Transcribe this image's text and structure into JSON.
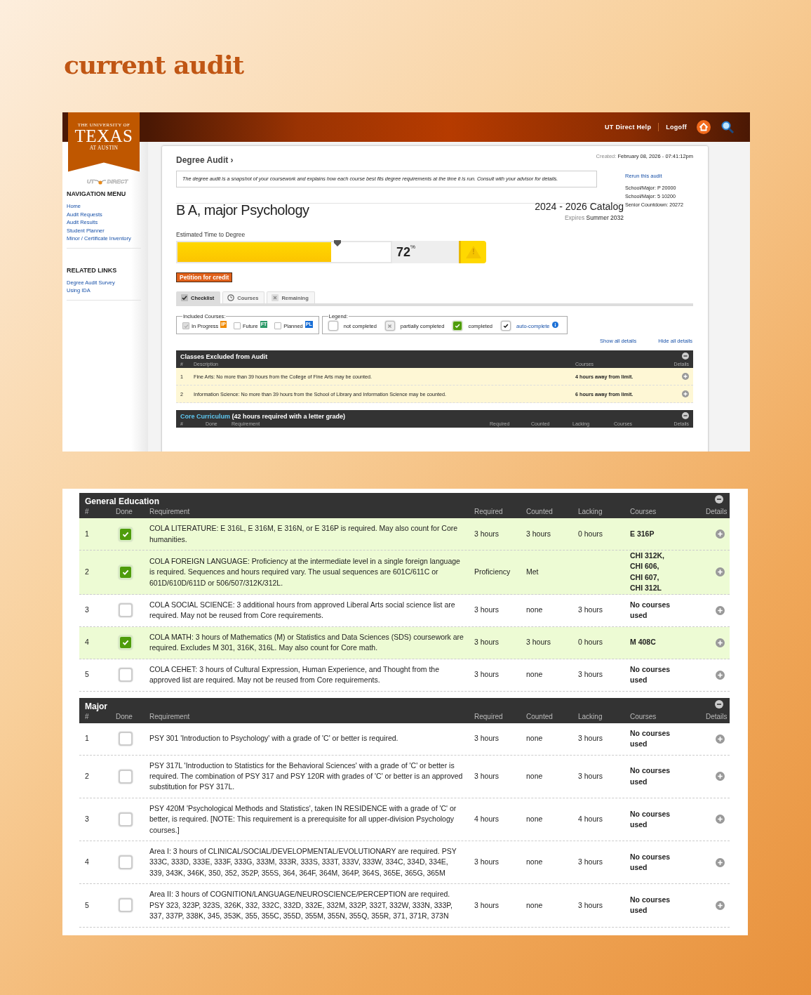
{
  "page_title": "current audit",
  "portal": {
    "header_links": [
      "UT Direct Help",
      "Logoff"
    ],
    "logo": {
      "line1": "THE UNIVERSITY OF",
      "line2": "TEXAS",
      "line3": "AT AUSTIN",
      "brand_left": "UT",
      "brand_right": "DIRECT"
    },
    "nav_sections": [
      {
        "title": "NAVIGATION MENU",
        "links": [
          "Home",
          "Audit Requests",
          "Audit Results",
          "Student Planner",
          "Minor / Certificate Inventory"
        ]
      },
      {
        "title": "RELATED LINKS",
        "links": [
          "Degree Audit Survey",
          "Using IDA"
        ]
      }
    ],
    "audit": {
      "breadcrumb": "Degree Audit ›",
      "created_label": "Created:",
      "created_value": "February 08, 2026 - 07:41:12pm",
      "notice": "The degree audit is a snapshot of your coursework and explains how each course best fits degree requirements at the time it is run. Consult with your advisor for details.",
      "rerun": "Rerun this audit",
      "info_lines": [
        "School/Major: P 20000",
        "School/Major: 5 10200",
        "Senior Countdown: 20272"
      ],
      "degree": "B A, major Psychology",
      "catalog": "2024 - 2026 Catalog",
      "expires_label": "Expires",
      "expires_value": "Summer 2032",
      "progress": {
        "label": "Estimated Time to Degree",
        "level": 0.72,
        "reading": "72",
        "unit": "%",
        "warning": "!"
      },
      "petition": "Petition for credit",
      "tabs": [
        {
          "label": "Checklist",
          "kind": "check",
          "selected": true
        },
        {
          "label": "Courses",
          "kind": "clock",
          "selected": false
        },
        {
          "label": "Remaining",
          "kind": "cross",
          "selected": false
        }
      ],
      "included": {
        "legend": "Included Courses:",
        "items": [
          {
            "label": "In Progress",
            "checked": true,
            "badge": "IP",
            "color": "#f08a00"
          },
          {
            "label": "Future",
            "checked": false,
            "badge": "FT",
            "color": "#2e9a6a"
          },
          {
            "label": "Planned",
            "checked": false,
            "badge": "PL",
            "color": "#1a6fd6"
          }
        ]
      },
      "legend": {
        "legend": "Legend:",
        "items": [
          {
            "kind": "empty",
            "label": "not completed"
          },
          {
            "kind": "partial",
            "label": "partially completed"
          },
          {
            "kind": "complete",
            "label": "completed"
          },
          {
            "kind": "auto",
            "label": "auto-complete"
          }
        ]
      },
      "detail_links": [
        "Show all details",
        "Hide all details"
      ],
      "excluded": {
        "title": "Classes Excluded from Audit",
        "columns": [
          "#",
          "Description",
          "Courses",
          "Details"
        ],
        "rows": [
          {
            "num": "1",
            "description": "Fine Arts: No more than 39 hours from the College of Fine Arts may be counted.",
            "courses": "4 hours away from limit."
          },
          {
            "num": "2",
            "description": "Information Science: No more than 39 hours from the School of Library and Information Science may be counted.",
            "courses": "6 hours away from limit."
          }
        ]
      },
      "core": {
        "title_link": "Core Curriculum",
        "title_rest": "(42 hours required with a letter grade)",
        "columns": [
          "#",
          "Done",
          "Requirement",
          "Required",
          "Counted",
          "Lacking",
          "Courses",
          "Details"
        ]
      }
    }
  },
  "detail": {
    "sections": [
      {
        "title": "General Education",
        "columns": [
          "#",
          "Done",
          "Requirement",
          "Required",
          "Counted",
          "Lacking",
          "Courses",
          "Details"
        ],
        "rows": [
          {
            "num": "1",
            "done": true,
            "requirement": "COLA LITERATURE: E 316L, E 316M, E 316N, or E 316P is required. May also count for Core humanities.",
            "required": "3 hours",
            "counted": "3 hours",
            "lacking": "0 hours",
            "courses": "E 316P"
          },
          {
            "num": "2",
            "done": true,
            "requirement": "COLA FOREIGN LANGUAGE: Proficiency at the intermediate level in a single foreign language is required. Sequences and hours required vary. The usual sequences are 601C/611C or 601D/610D/611D or 506/507/312K/312L.",
            "required": "Proficiency",
            "counted": "Met",
            "courses": "CHI 312K, CHI 606, CHI 607, CHI 312L"
          },
          {
            "num": "3",
            "done": false,
            "requirement": "COLA SOCIAL SCIENCE: 3 additional hours from approved Liberal Arts social science list are required. May not be reused from Core requirements.",
            "required": "3 hours",
            "counted": "none",
            "lacking": "3 hours",
            "courses": "No courses used"
          },
          {
            "num": "4",
            "done": true,
            "requirement": "COLA MATH: 3 hours of Mathematics (M) or Statistics and Data Sciences (SDS) coursework are required. Excludes M 301, 316K, 316L. May also count for Core math.",
            "required": "3 hours",
            "counted": "3 hours",
            "lacking": "0 hours",
            "courses": "M 408C"
          },
          {
            "num": "5",
            "done": false,
            "requirement": "COLA CEHET: 3 hours of Cultural Expression, Human Experience, and Thought from the approved list are required. May not be reused from Core requirements.",
            "required": "3 hours",
            "counted": "none",
            "lacking": "3 hours",
            "courses": "No courses used"
          }
        ]
      },
      {
        "title": "Major",
        "columns": [
          "#",
          "Done",
          "Requirement",
          "Required",
          "Counted",
          "Lacking",
          "Courses",
          "Details"
        ],
        "rows": [
          {
            "num": "1",
            "done": false,
            "requirement": "PSY 301 'Introduction to Psychology' with a grade of 'C' or better is required.",
            "required": "3 hours",
            "counted": "none",
            "lacking": "3 hours",
            "courses": "No courses used"
          },
          {
            "num": "2",
            "done": false,
            "requirement": "PSY 317L 'Introduction to Statistics for the Behavioral Sciences' with a grade of 'C' or better is required. The combination of PSY 317 and PSY 120R with grades of 'C' or better is an approved substitution for PSY 317L.",
            "required": "3 hours",
            "counted": "none",
            "lacking": "3 hours",
            "courses": "No courses used"
          },
          {
            "num": "3",
            "done": false,
            "requirement": "PSY 420M 'Psychological Methods and Statistics', taken IN RESIDENCE with a grade of 'C' or better, is required. [NOTE: This requirement is a prerequisite for all upper-division Psychology courses.]",
            "required": "4 hours",
            "counted": "none",
            "lacking": "4 hours",
            "courses": "No courses used"
          },
          {
            "num": "4",
            "done": false,
            "requirement": "Area I: 3 hours of CLINICAL/SOCIAL/DEVELOPMENTAL/EVOLUTIONARY are required. PSY 333C, 333D, 333E, 333F, 333G, 333M, 333R, 333S, 333T, 333V, 333W, 334C, 334D, 334E, 339, 343K, 346K, 350, 352, 352P, 355S, 364, 364F, 364M, 364P, 364S, 365E, 365G, 365M",
            "required": "3 hours",
            "counted": "none",
            "lacking": "3 hours",
            "courses": "No courses used"
          },
          {
            "num": "5",
            "done": false,
            "requirement": "Area II: 3 hours of COGNITION/LANGUAGE/NEUROSCIENCE/PERCEPTION are required. PSY 323, 323P, 323S, 326K, 332, 332C, 332D, 332E, 332M, 332P, 332T, 332W, 333N, 333P, 337, 337P, 338K, 345, 353K, 355, 355C, 355D, 355M, 355N, 355Q, 355R, 371, 371R, 373N",
            "required": "3 hours",
            "counted": "none",
            "lacking": "3 hours",
            "courses": "No courses used"
          }
        ]
      }
    ]
  }
}
